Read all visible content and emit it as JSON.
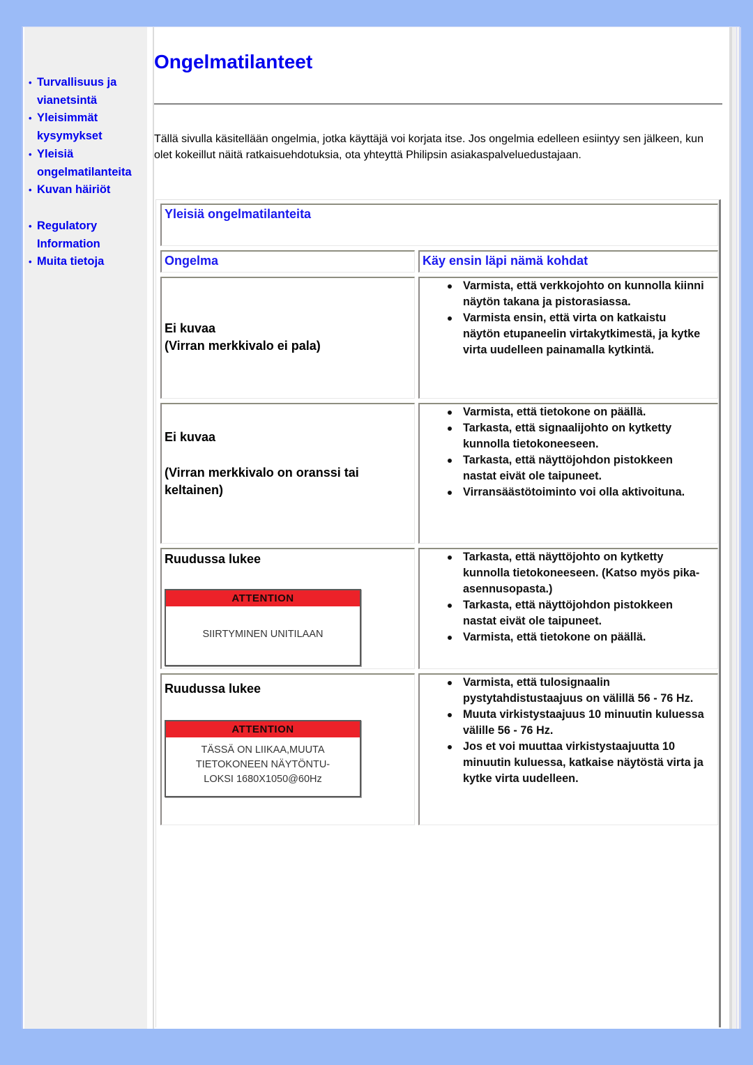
{
  "sidebar": {
    "items": [
      {
        "label": "Turvallisuus ja vianetsintä"
      },
      {
        "label": "Yleisimmät kysymykset"
      },
      {
        "label": "Yleisiä ongelmatilanteita"
      },
      {
        "label": "Kuvan häiriöt"
      },
      {
        "label": "Regulatory Information"
      },
      {
        "label": "Muita tietoja"
      }
    ]
  },
  "page": {
    "title": "Ongelmatilanteet",
    "intro": "Tällä sivulla käsitellään ongelmia, jotka käyttäjä voi korjata itse. Jos ongelmia edelleen esiintyy sen jälkeen, kun olet kokeillut näitä ratkaisuehdotuksia, ota yhteyttä Philipsin asiakaspalveluedustajaan."
  },
  "table": {
    "section_title": "Yleisiä ongelmatilanteita",
    "col_problem": "Ongelma",
    "col_checks": "Käy ensin läpi nämä kohdat",
    "rows": [
      {
        "problem_line1": "Ei kuvaa",
        "problem_line2": "(Virran merkkivalo ei pala)",
        "checks": [
          "Varmista, että verkkojohto on kunnolla kiinni näytön takana ja pistorasiassa.",
          "Varmista ensin, että virta on katkaistu näytön etupaneelin virtakytkimestä, ja kytke virta uudelleen painamalla kytkintä."
        ]
      },
      {
        "problem_line1": "Ei kuvaa",
        "problem_line2": "(Virran merkkivalo on oranssi tai keltainen)",
        "checks": [
          "Varmista, että tietokone on päällä.",
          "Tarkasta, että signaalijohto on kytketty kunnolla tietokoneeseen.",
          "Tarkasta, että näyttöjohdon pistokkeen nastat eivät ole taipuneet.",
          "Virransäästötoiminto voi olla aktivoituna."
        ]
      },
      {
        "problem_line1": "Ruudussa lukee",
        "attention_header": "ATTENTION",
        "attention_lines": [
          "SIIRTYMINEN UNITILAAN"
        ],
        "checks": [
          "Tarkasta, että näyttöjohto on kytketty kunnolla tietokoneeseen. (Katso myös pika-asennusopasta.)",
          "Tarkasta, että näyttöjohdon pistokkeen nastat eivät ole taipuneet.",
          "Varmista, että tietokone on päällä."
        ]
      },
      {
        "problem_line1": "Ruudussa lukee",
        "attention_header": "ATTENTION",
        "attention_lines": [
          "TÄSSÄ ON LIIKAA,MUUTA",
          "TIETOKONEEN NÄYTÖNTU-",
          "LOKSI 1680X1050@60Hz"
        ],
        "checks": [
          "Varmista, että tulosignaalin pystytahdistustaajuus on välillä 56 - 76 Hz.",
          "Muuta virkistystaajuus 10 minuutin kuluessa välille 56 - 76 Hz.",
          "Jos et voi muuttaa virkistystaajuutta 10 minuutin kuluessa, katkaise näytöstä virta ja kytke virta uudelleen."
        ]
      }
    ]
  },
  "colors": {
    "background": "#9bbbf7",
    "link": "#0000ee",
    "attention_red": "#ec2229"
  }
}
